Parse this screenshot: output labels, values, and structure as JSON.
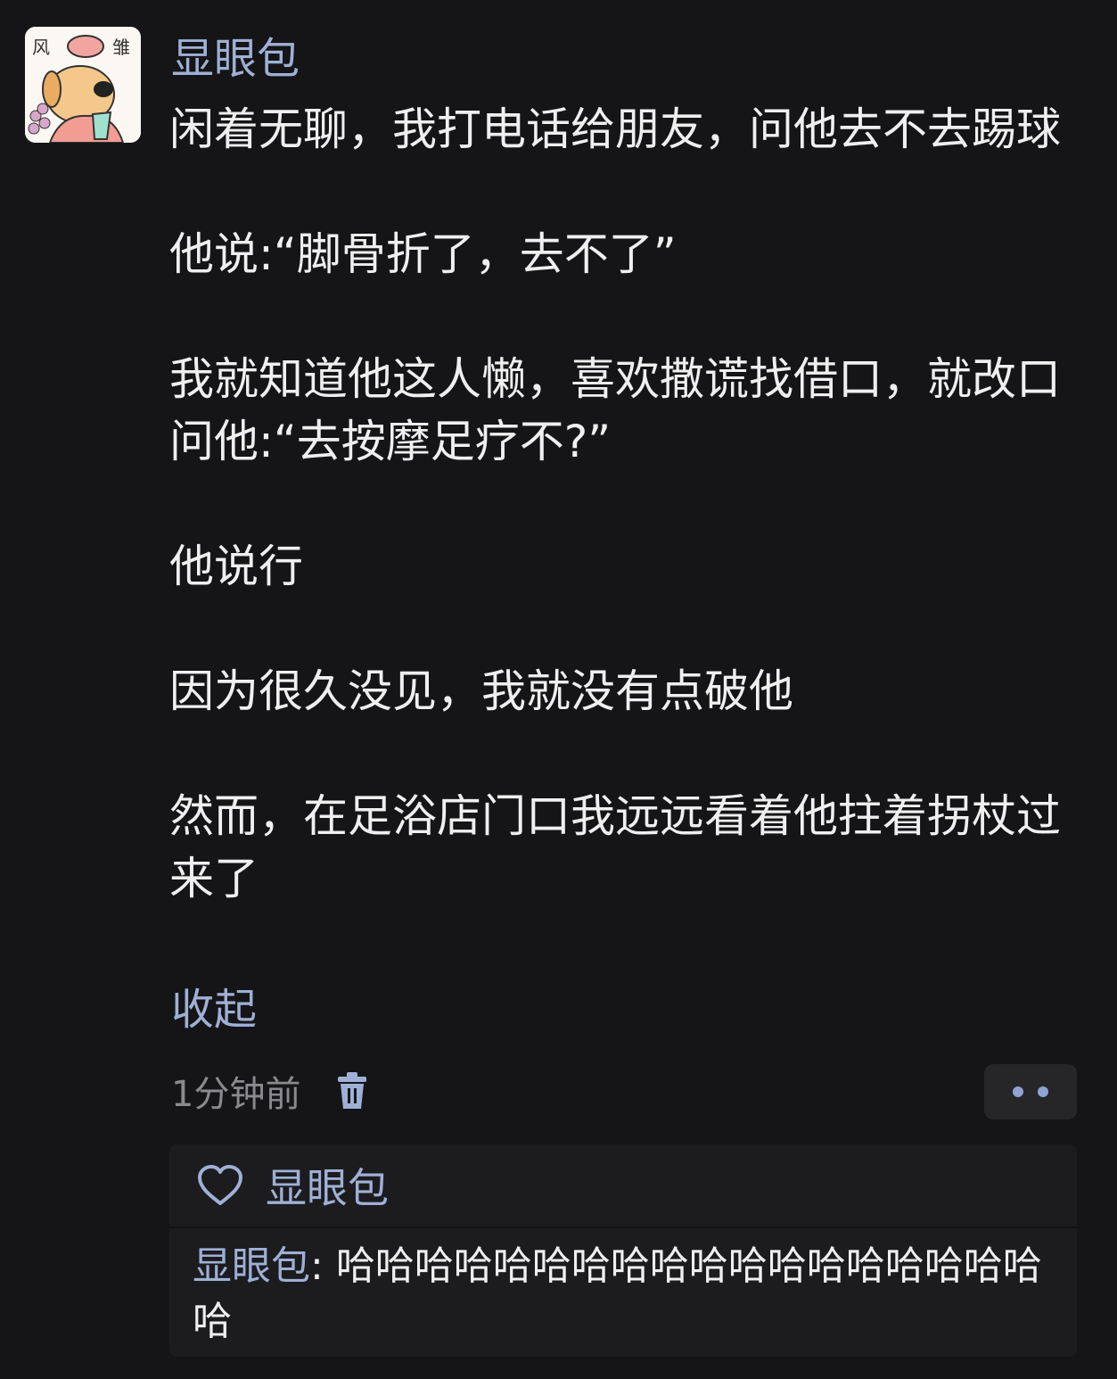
{
  "post": {
    "author": "显眼包",
    "paragraphs": [
      "闲着无聊，我打电话给朋友，问他去不去踢球",
      "他说:“脚骨折了，去不了”",
      "我就知道他这人懒，喜欢撒谎找借口，就改口问他:“去按摩足疗不?”",
      "他说行",
      "因为很久没见，我就没有点破他",
      "然而，在足浴店门口我远远看着他拄着拐杖过来了"
    ],
    "collapse_label": "收起",
    "time": "1分钟前",
    "avatar_text_left": "风",
    "avatar_text_right": "雏"
  },
  "likes": {
    "liker": "显眼包"
  },
  "reply": {
    "name": "显眼包",
    "separator": ": ",
    "text": "哈哈哈哈哈哈哈哈哈哈哈哈哈哈哈哈哈哈哈"
  },
  "colors": {
    "background": "#151517",
    "accent": "#9fb0d6",
    "text": "#efefef",
    "muted": "#8a8a8e"
  }
}
